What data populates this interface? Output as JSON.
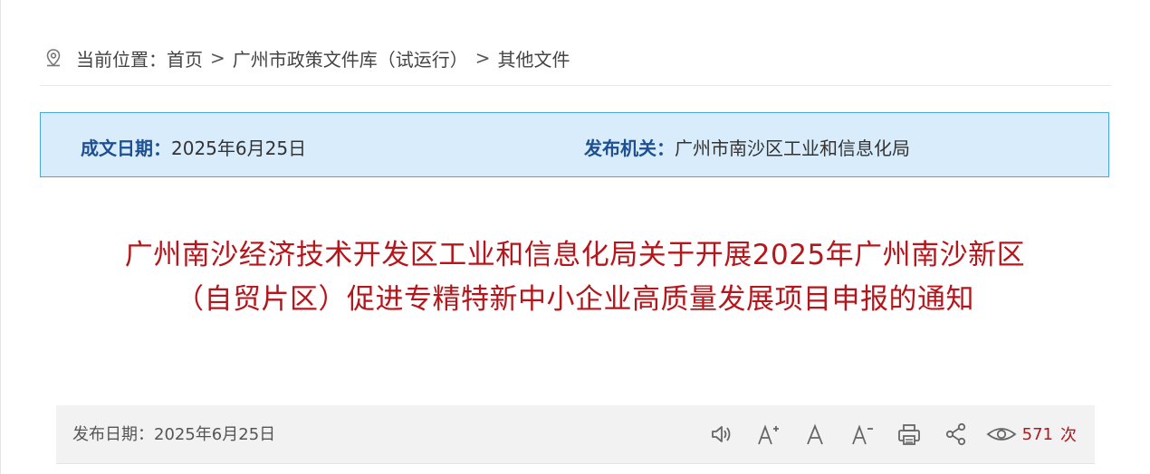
{
  "breadcrumb": {
    "label": "当前位置：",
    "items": [
      "首页",
      "广州市政策文件库（试运行）",
      "其他文件"
    ],
    "separator": ">"
  },
  "meta": {
    "date_label": "成文日期：",
    "date_value": "2025年6月25日",
    "org_label": "发布机关：",
    "org_value": "广州市南沙区工业和信息化局"
  },
  "document": {
    "title": "广州南沙经济技术开发区工业和信息化局关于开展2025年广州南沙新区（自贸片区）促进专精特新中小企业高质量发展项目申报的通知"
  },
  "toolbar": {
    "publish_date": "发布日期：2025年6月25日",
    "icons": [
      "speaker-icon",
      "font-increase-icon",
      "font-reset-icon",
      "font-decrease-icon",
      "print-icon",
      "share-icon",
      "eye-icon"
    ],
    "view_count": "571",
    "view_unit": "次"
  },
  "colors": {
    "title_red": "#b5161b",
    "label_blue": "#1d4f91",
    "box_bg": "#d8ecfb",
    "box_border": "#48a6d8"
  }
}
